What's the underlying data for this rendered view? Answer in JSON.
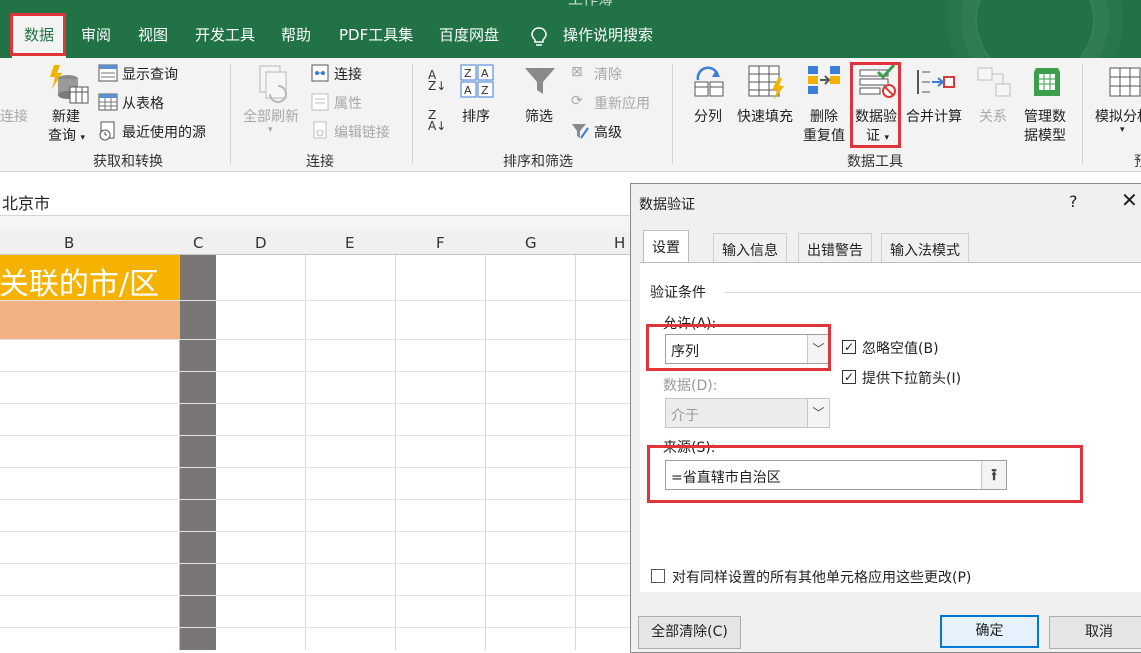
{
  "ribbon_tabs": [
    "数据",
    "审阅",
    "视图",
    "开发工具",
    "帮助",
    "PDF工具集",
    "百度网盘",
    "操作说明搜索"
  ],
  "title_fragment": "工作簿",
  "ribbon": {
    "get_transform": {
      "partial_left": "连接",
      "new_query": [
        "新建",
        "查询"
      ],
      "show_queries": "显示查询",
      "from_table": "从表格",
      "recent_sources": "最近使用的源",
      "group": "获取和转换"
    },
    "connections": {
      "refresh_all": "全部刷新",
      "connections": "连接",
      "properties": "属性",
      "edit_links": "编辑链接",
      "group": "连接"
    },
    "sort_filter": {
      "sort": "排序",
      "filter": "筛选",
      "clear": "清除",
      "reapply": "重新应用",
      "advanced": "高级",
      "group": "排序和筛选"
    },
    "data_tools": {
      "text_to_columns": "分列",
      "flash_fill": "快速填充",
      "remove_duplicates": [
        "删除",
        "重复值"
      ],
      "data_validation": [
        "数据验",
        "证"
      ],
      "consolidate": "合并计算",
      "relationships": "关系",
      "manage_model": [
        "管理数",
        "据模型"
      ],
      "group": "数据工具"
    },
    "forecast": {
      "what_if": "模拟分析",
      "partial_group": "预"
    }
  },
  "formula_bar": {
    "value": "北京市"
  },
  "sheet": {
    "columns": [
      "B",
      "C",
      "D",
      "E",
      "F",
      "G",
      "H"
    ],
    "header_cell": "关联的市/区"
  },
  "dialog": {
    "title": "数据验证",
    "help": "?",
    "close": "✕",
    "tabs": [
      "设置",
      "输入信息",
      "出错警告",
      "输入法模式"
    ],
    "section": "验证条件",
    "allow_label": "允许(A):",
    "allow_value": "序列",
    "data_label": "数据(D):",
    "data_value": "介于",
    "ignore_blank": {
      "label": "忽略空值(B)",
      "checked": true
    },
    "in_cell_dropdown": {
      "label": "提供下拉箭头(I)",
      "checked": true
    },
    "source_label": "来源(S):",
    "source_value": "=省直辖市自治区",
    "apply_all": {
      "label": "对有同样设置的所有其他单元格应用这些更改(P)",
      "checked": false
    },
    "clear_all": "全部清除(C)",
    "ok": "确定",
    "cancel": "取消"
  },
  "colors": {
    "excel_green": "#217346",
    "highlight_red": "#e0343c",
    "header_fill": "#f6b200",
    "row_fill": "#f4b183",
    "gray_column": "#7a7676"
  }
}
